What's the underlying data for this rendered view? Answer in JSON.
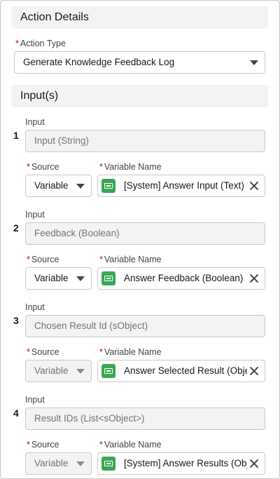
{
  "action_details": {
    "header": "Action Details",
    "action_type": {
      "label": "Action Type",
      "value": "Generate Knowledge Feedback Log"
    }
  },
  "inputs": {
    "header": "Input(s)",
    "input_label": "Input",
    "source_label": "Source",
    "variable_name_label": "Variable Name",
    "rows": [
      {
        "number": "1",
        "input_value": "Input (String)",
        "source": "Variable",
        "source_disabled": false,
        "variable": "[System] Answer Input (Text)"
      },
      {
        "number": "2",
        "input_value": "Feedback (Boolean)",
        "source": "Variable",
        "source_disabled": false,
        "variable": "Answer Feedback (Boolean)"
      },
      {
        "number": "3",
        "input_value": "Chosen Result Id (sObject)",
        "source": "Variable",
        "source_disabled": true,
        "variable": "Answer Selected Result (Object)"
      },
      {
        "number": "4",
        "input_value": "Result IDs (List<sObject>)",
        "source": "Variable",
        "source_disabled": true,
        "variable": "[System] Answer Results (Object)"
      }
    ]
  },
  "icons": {
    "variable": "variable-icon",
    "clear": "close-icon",
    "dropdown": "chevron-down-icon"
  },
  "colors": {
    "required": "#ba0517",
    "variable_icon": "#3ba755"
  }
}
